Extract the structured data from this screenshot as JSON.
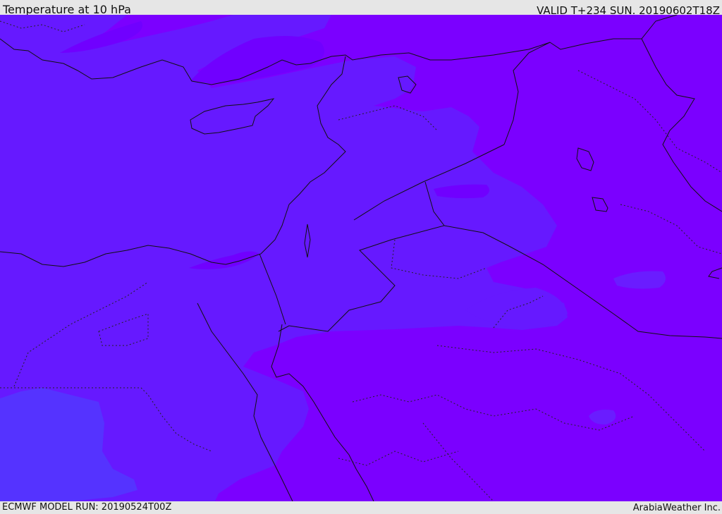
{
  "header": {
    "title": "Temperature at 10 hPa",
    "valid": "VALID T+234 SUN. 20190602T18Z"
  },
  "footer": {
    "model_run": "ECMWF MODEL RUN: 20190524T00Z",
    "credit": "ArabiaWeather Inc."
  },
  "colors": {
    "warm_purple": "#7b00ff",
    "mid_violet": "#6619ff",
    "cool_blue_violet": "#5533ff",
    "borders": "#111111"
  }
}
